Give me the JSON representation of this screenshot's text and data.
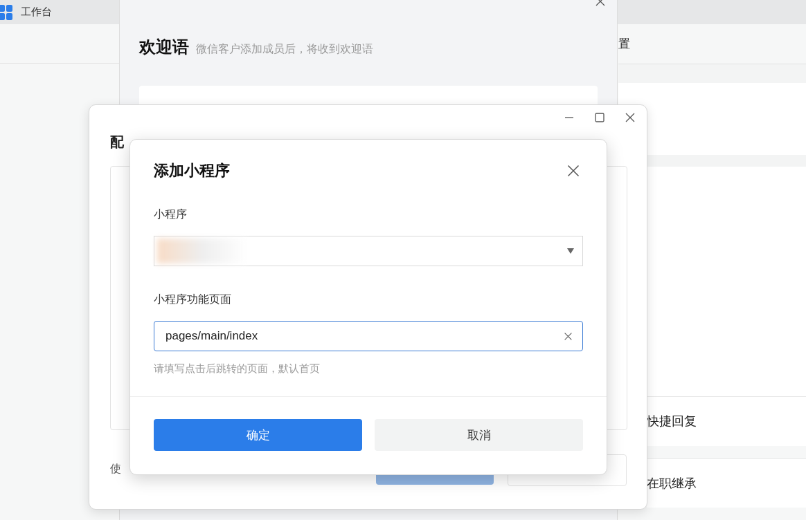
{
  "background_app": {
    "header": {
      "title": "工作台"
    },
    "right_panel": {
      "heading": "置",
      "items": [
        {
          "label": "快捷回复"
        },
        {
          "label": "在职继承"
        }
      ]
    }
  },
  "welcome_window": {
    "title": "欢迎语",
    "subtitle": "微信客户添加成员后，将收到欢迎语"
  },
  "config_window": {
    "title": "配",
    "footer_label": "使"
  },
  "dialog": {
    "title": "添加小程序",
    "fields": [
      {
        "kind": "select",
        "label": "小程序"
      },
      {
        "kind": "text",
        "label": "小程序功能页面",
        "value": "pages/main/index",
        "hint": "请填写点击后跳转的页面，默认首页"
      }
    ],
    "buttons": [
      {
        "label": "确定",
        "primary": true
      },
      {
        "label": "取消",
        "primary": false
      }
    ]
  }
}
